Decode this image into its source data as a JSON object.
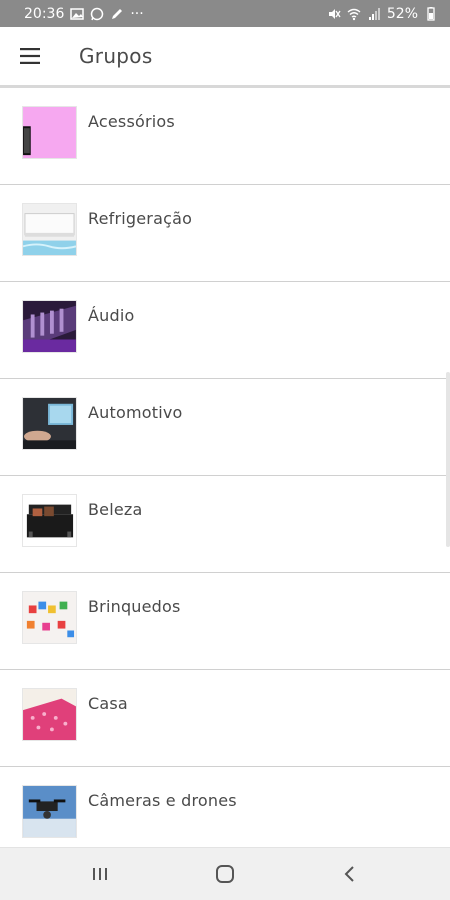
{
  "status": {
    "time": "20:36",
    "dots": "···",
    "battery": "52%"
  },
  "appbar": {
    "title": "Grupos",
    "menu_icon": "hamburger-menu-icon"
  },
  "groups": [
    {
      "label": "Acessórios",
      "thumb": "accessories"
    },
    {
      "label": "Refrigeração",
      "thumb": "air-conditioner"
    },
    {
      "label": "Áudio",
      "thumb": "audio-mixer"
    },
    {
      "label": "Automotivo",
      "thumb": "car-dashboard"
    },
    {
      "label": "Beleza",
      "thumb": "makeup-case"
    },
    {
      "label": "Brinquedos",
      "thumb": "toy-blocks"
    },
    {
      "label": "Casa",
      "thumb": "pink-bedding"
    },
    {
      "label": "Câmeras e drones",
      "thumb": "drone"
    }
  ],
  "navbar": {
    "recents_icon": "recent-apps-icon",
    "home_icon": "home-icon",
    "back_icon": "back-icon"
  },
  "colors": {
    "status_bar": "#8a8a8a",
    "nav_bar": "#f0f0f0",
    "divider": "#d0d0d0"
  }
}
